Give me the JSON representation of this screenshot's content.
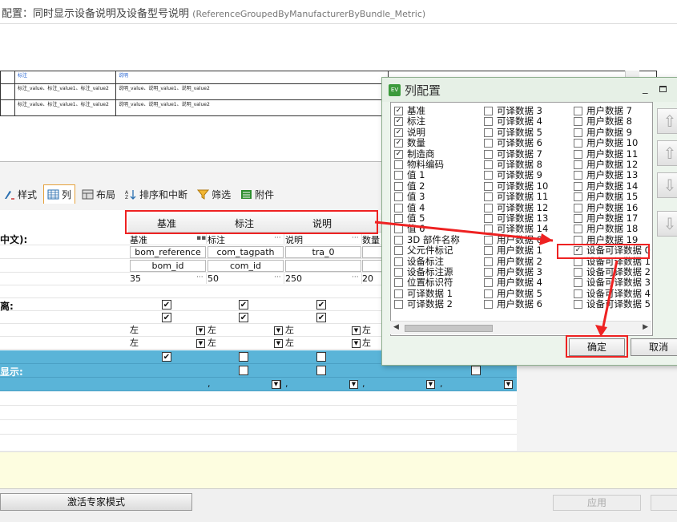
{
  "window": {
    "title": "配置：同时显示设备说明及设备型号说明",
    "subtitle": "(ReferenceGroupedByManufacturerByBundle_Metric)"
  },
  "preview": {
    "header": [
      "",
      "标注",
      "说明"
    ],
    "rows": [
      [
        "",
        "标注_value、标注_value1、标注_value2",
        "说明_value、说明_value1、说明_value2"
      ],
      [
        "",
        "标注_value、标注_value1、标注_value2",
        "说明_value、说明_value1、说明_value2"
      ]
    ]
  },
  "tabs": [
    {
      "label": "样式",
      "icon": "style-icon"
    },
    {
      "label": "列",
      "icon": "table-icon"
    },
    {
      "label": "布局",
      "icon": "layout-icon"
    },
    {
      "label": "排序和中断",
      "icon": "sort-icon"
    },
    {
      "label": "筛选",
      "icon": "filter-icon"
    },
    {
      "label": "附件",
      "icon": "attachment-icon"
    }
  ],
  "grid": {
    "columns": [
      "基准",
      "标注",
      "说明"
    ],
    "row_labels": {
      "name": "中文):",
      "separate": "离:",
      "display": "显示:"
    },
    "names": [
      "基准",
      "标注",
      "说明",
      "数量"
    ],
    "props1": [
      "bom_reference",
      "com_tagpath",
      "tra_0"
    ],
    "props2": [
      "bom_id",
      "com_id"
    ],
    "widths": [
      "35",
      "50",
      "250",
      "20"
    ],
    "align": "左",
    "comma": ","
  },
  "buttons": {
    "expert": "激活专家模式",
    "apply": "应用"
  },
  "dialog": {
    "title": "列配置",
    "ok": "确定",
    "cancel": "取消",
    "columns": [
      [
        {
          "label": "基准",
          "checked": true
        },
        {
          "label": "标注",
          "checked": true
        },
        {
          "label": "说明",
          "checked": true
        },
        {
          "label": "数量",
          "checked": true
        },
        {
          "label": "制造商",
          "checked": true
        },
        {
          "label": "物料编码",
          "checked": false
        },
        {
          "label": "值 1",
          "checked": false
        },
        {
          "label": "值 2",
          "checked": false
        },
        {
          "label": "值 3",
          "checked": false
        },
        {
          "label": "值 4",
          "checked": false
        },
        {
          "label": "值 5",
          "checked": false
        },
        {
          "label": "值 6",
          "checked": false
        },
        {
          "label": "3D 部件名称",
          "checked": false
        },
        {
          "label": "父元件标记",
          "checked": false
        },
        {
          "label": "设备标注",
          "checked": false
        },
        {
          "label": "设备标注源",
          "checked": false
        },
        {
          "label": "位置标识符",
          "checked": false
        },
        {
          "label": "可译数据 1",
          "checked": false
        },
        {
          "label": "可译数据 2",
          "checked": false
        }
      ],
      [
        {
          "label": "可译数据 3",
          "checked": false
        },
        {
          "label": "可译数据 4",
          "checked": false
        },
        {
          "label": "可译数据 5",
          "checked": false
        },
        {
          "label": "可译数据 6",
          "checked": false
        },
        {
          "label": "可译数据 7",
          "checked": false
        },
        {
          "label": "可译数据 8",
          "checked": false
        },
        {
          "label": "可译数据 9",
          "checked": false
        },
        {
          "label": "可译数据 10",
          "checked": false
        },
        {
          "label": "可译数据 11",
          "checked": false
        },
        {
          "label": "可译数据 12",
          "checked": false
        },
        {
          "label": "可译数据 13",
          "checked": false
        },
        {
          "label": "可译数据 14",
          "checked": false
        },
        {
          "label": "用户数据 0",
          "checked": false
        },
        {
          "label": "用户数据 1",
          "checked": false
        },
        {
          "label": "用户数据 2",
          "checked": false
        },
        {
          "label": "用户数据 3",
          "checked": false
        },
        {
          "label": "用户数据 4",
          "checked": false
        },
        {
          "label": "用户数据 5",
          "checked": false
        },
        {
          "label": "用户数据 6",
          "checked": false
        }
      ],
      [
        {
          "label": "用户数据 7",
          "checked": false
        },
        {
          "label": "用户数据 8",
          "checked": false
        },
        {
          "label": "用户数据 9",
          "checked": false
        },
        {
          "label": "用户数据 10",
          "checked": false
        },
        {
          "label": "用户数据 11",
          "checked": false
        },
        {
          "label": "用户数据 12",
          "checked": false
        },
        {
          "label": "用户数据 13",
          "checked": false
        },
        {
          "label": "用户数据 14",
          "checked": false
        },
        {
          "label": "用户数据 15",
          "checked": false
        },
        {
          "label": "用户数据 16",
          "checked": false
        },
        {
          "label": "用户数据 17",
          "checked": false
        },
        {
          "label": "用户数据 18",
          "checked": false
        },
        {
          "label": "用户数据 19",
          "checked": false
        },
        {
          "label": "设备可译数据 0",
          "checked": true
        },
        {
          "label": "设备可译数据 1",
          "checked": false
        },
        {
          "label": "设备可译数据 2",
          "checked": false
        },
        {
          "label": "设备可译数据 3",
          "checked": false
        },
        {
          "label": "设备可译数据 4",
          "checked": false
        },
        {
          "label": "设备可译数据 5",
          "checked": false
        }
      ]
    ]
  },
  "colors": {
    "highlight": "#e22222",
    "row_blue": "#5ab4d8",
    "info_bg": "#fdfde0"
  }
}
